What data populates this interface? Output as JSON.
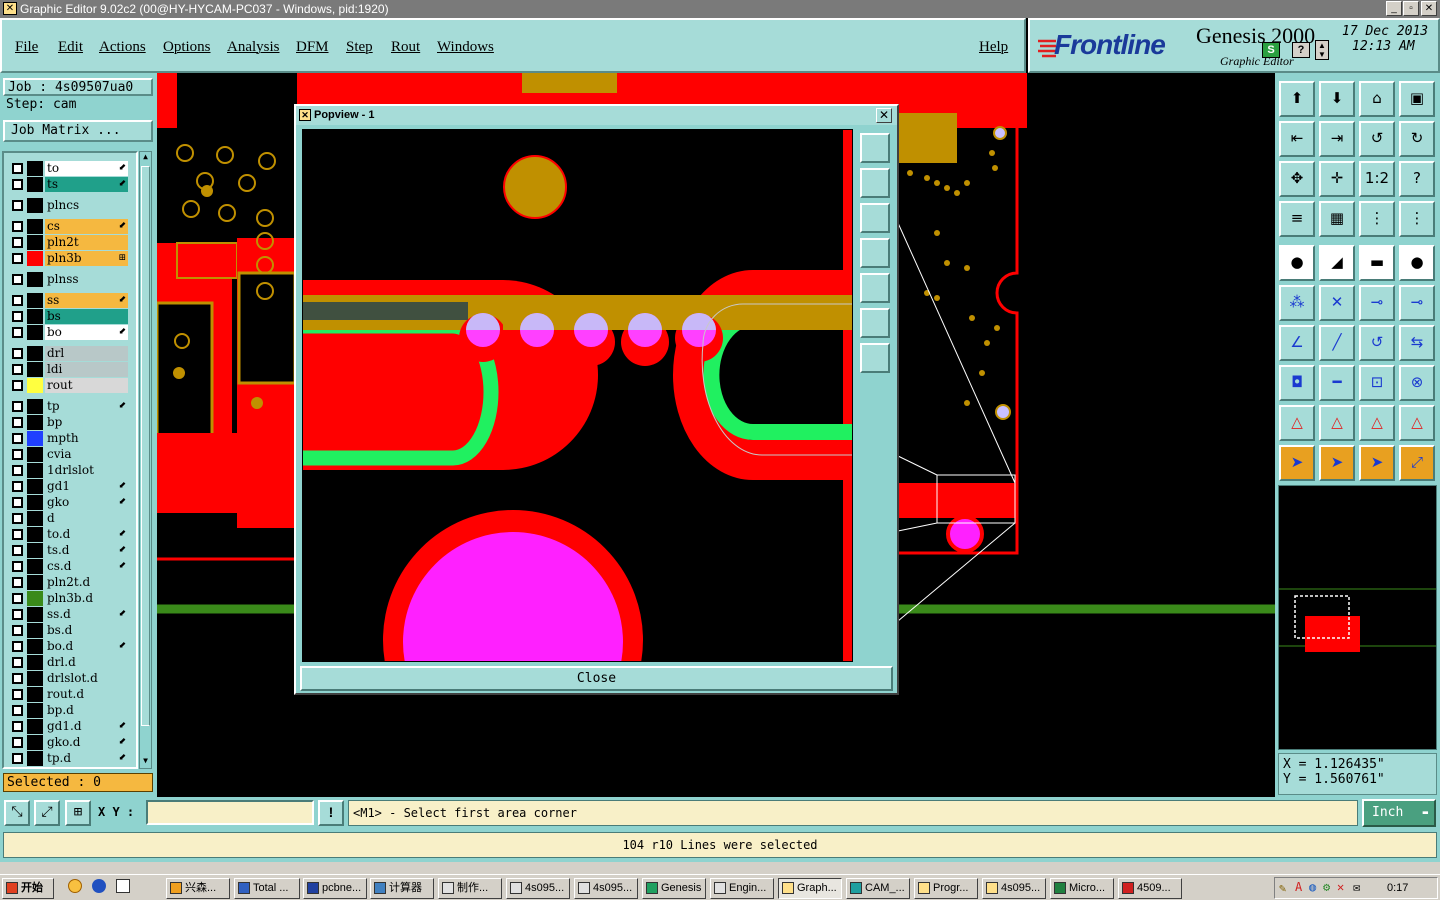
{
  "window": {
    "title": "Graphic Editor 9.02c2 (00@HY-HYCAM-PC037 - Windows, pid:1920)"
  },
  "menu": [
    "File",
    "Edit",
    "Actions",
    "Options",
    "Analysis",
    "DFM",
    "Step",
    "Rout",
    "Windows"
  ],
  "help_label": "Help",
  "brand": {
    "logo": "Frontline",
    "product": "Genesis 2000",
    "subtitle": "Graphic Editor",
    "date": "17 Dec 2013",
    "time": "12:13 AM"
  },
  "job": {
    "job_text": "Job : 4s09507ua0",
    "step_text": "Step: cam",
    "matrix_label": "Job Matrix ..."
  },
  "layers": [
    {
      "name": "to",
      "color": "#ffffff",
      "swatch": "#000000",
      "mark": "⬋"
    },
    {
      "name": "ts",
      "color": "#20a08a",
      "swatch": "#000000",
      "mark": "⬋"
    },
    {
      "name": "plncs",
      "color": "#a6dcd8",
      "swatch": "#000000",
      "mark": ""
    },
    {
      "name": "cs",
      "color": "#f5b840",
      "swatch": "#000000",
      "mark": "⬋"
    },
    {
      "name": "pln2t",
      "color": "#f5b840",
      "swatch": "#000000",
      "mark": ""
    },
    {
      "name": "pln3b",
      "color": "#f5b840",
      "swatch": "#ff0000",
      "mark": "⊞"
    },
    {
      "name": "plnss",
      "color": "#a6dcd8",
      "swatch": "#000000",
      "mark": ""
    },
    {
      "name": "ss",
      "color": "#f5b840",
      "swatch": "#000000",
      "mark": "⬋"
    },
    {
      "name": "bs",
      "color": "#20a08a",
      "swatch": "#000000",
      "mark": ""
    },
    {
      "name": "bo",
      "color": "#ffffff",
      "swatch": "#000000",
      "mark": "⬋"
    },
    {
      "name": "drl",
      "color": "#b8c8c8",
      "swatch": "#000000",
      "mark": ""
    },
    {
      "name": "ldi",
      "color": "#b8c8c8",
      "swatch": "#000000",
      "mark": ""
    },
    {
      "name": "rout",
      "color": "#d8d8d8",
      "swatch": "#ffff40",
      "mark": ""
    },
    {
      "name": "tp",
      "color": "#a6dcd8",
      "swatch": "#000000",
      "mark": "⬋"
    },
    {
      "name": "bp",
      "color": "#a6dcd8",
      "swatch": "#000000",
      "mark": ""
    },
    {
      "name": "mpth",
      "color": "#a6dcd8",
      "swatch": "#2040ff",
      "mark": ""
    },
    {
      "name": "cvia",
      "color": "#a6dcd8",
      "swatch": "#000000",
      "mark": ""
    },
    {
      "name": "1drlslot",
      "color": "#a6dcd8",
      "swatch": "#000000",
      "mark": ""
    },
    {
      "name": "gd1",
      "color": "#a6dcd8",
      "swatch": "#000000",
      "mark": "⬋"
    },
    {
      "name": "gko",
      "color": "#a6dcd8",
      "swatch": "#000000",
      "mark": "⬋"
    },
    {
      "name": "d",
      "color": "#a6dcd8",
      "swatch": "#000000",
      "mark": ""
    },
    {
      "name": "to.d",
      "color": "#a6dcd8",
      "swatch": "#000000",
      "mark": "⬋"
    },
    {
      "name": "ts.d",
      "color": "#a6dcd8",
      "swatch": "#000000",
      "mark": "⬋"
    },
    {
      "name": "cs.d",
      "color": "#a6dcd8",
      "swatch": "#000000",
      "mark": "⬋"
    },
    {
      "name": "pln2t.d",
      "color": "#a6dcd8",
      "swatch": "#000000",
      "mark": ""
    },
    {
      "name": "pln3b.d",
      "color": "#a6dcd8",
      "swatch": "#3a8a1a",
      "mark": ""
    },
    {
      "name": "ss.d",
      "color": "#a6dcd8",
      "swatch": "#000000",
      "mark": "⬋"
    },
    {
      "name": "bs.d",
      "color": "#a6dcd8",
      "swatch": "#000000",
      "mark": ""
    },
    {
      "name": "bo.d",
      "color": "#a6dcd8",
      "swatch": "#000000",
      "mark": "⬋"
    },
    {
      "name": "drl.d",
      "color": "#a6dcd8",
      "swatch": "#000000",
      "mark": ""
    },
    {
      "name": "drlslot.d",
      "color": "#a6dcd8",
      "swatch": "#000000",
      "mark": ""
    },
    {
      "name": "rout.d",
      "color": "#a6dcd8",
      "swatch": "#000000",
      "mark": ""
    },
    {
      "name": "bp.d",
      "color": "#a6dcd8",
      "swatch": "#000000",
      "mark": ""
    },
    {
      "name": "gd1.d",
      "color": "#a6dcd8",
      "swatch": "#000000",
      "mark": "⬋"
    },
    {
      "name": "gko.d",
      "color": "#a6dcd8",
      "swatch": "#000000",
      "mark": "⬋"
    },
    {
      "name": "tp.d",
      "color": "#a6dcd8",
      "swatch": "#000000",
      "mark": "⬋"
    }
  ],
  "selected_text": "Selected : 0",
  "popup": {
    "title": "Popview - 1",
    "close_label": "Close"
  },
  "coords": {
    "x_text": "X = 1.126435\"",
    "y_text": "Y = 1.560761\""
  },
  "command": {
    "xy_label": "X Y :",
    "xy_value": "",
    "prompt": "<M1> - Select first area corner",
    "units": "Inch"
  },
  "status_message": "104 r10 Lines were selected",
  "taskbar": {
    "start": "开始",
    "tasks": [
      "兴森...",
      "Total ...",
      "pcbne...",
      "计算器",
      "制作...",
      "4s095...",
      "4s095...",
      "Genesis",
      "Engin...",
      "Graph...",
      "CAM_...",
      "Progr...",
      "4s095...",
      "Micro...",
      "4509..."
    ],
    "active_index": 9,
    "clock": "0:17"
  },
  "colors": {
    "panel": "#a6dcd8",
    "copper": "#ff0000",
    "gold": "#c09000",
    "pad_magenta": "#ff20ff",
    "trace_green": "#20f060"
  }
}
